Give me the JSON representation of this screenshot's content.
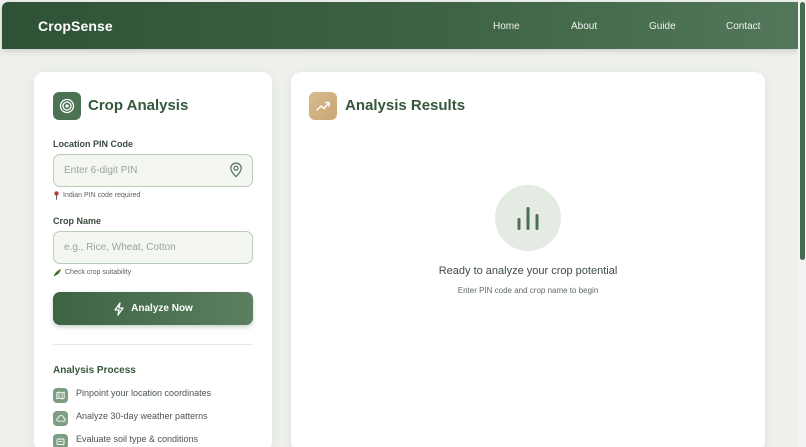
{
  "nav": {
    "brand": "CropSense",
    "links": [
      "Home",
      "About",
      "Guide",
      "Contact"
    ]
  },
  "analysis_form": {
    "title": "Crop Analysis",
    "title_icon": "target-icon",
    "pin_label": "Location PIN Code",
    "pin_placeholder": "Enter 6-digit PIN",
    "pin_value": "",
    "pin_hint": "Indian PIN code required",
    "crop_label": "Crop Name",
    "crop_placeholder": "e.g., Rice, Wheat, Cotton",
    "crop_value": "",
    "crop_hint": "Check crop suitability",
    "submit_label": "Analyze Now"
  },
  "process": {
    "title": "Analysis Process",
    "steps": [
      {
        "label": "Pinpoint your location coordinates",
        "icon": "map-icon"
      },
      {
        "label": "Analyze 30-day weather patterns",
        "icon": "cloud-icon"
      },
      {
        "label": "Evaluate soil type & conditions",
        "icon": "soil-icon"
      }
    ]
  },
  "results": {
    "title": "Analysis Results",
    "title_icon": "trending-up-icon",
    "empty_title": "Ready to analyze your crop potential",
    "empty_subtitle": "Enter PIN code and crop name to begin"
  },
  "colors": {
    "primary": "#3d6344",
    "accent_tan": "#d4b385",
    "background": "#eef0ec"
  }
}
